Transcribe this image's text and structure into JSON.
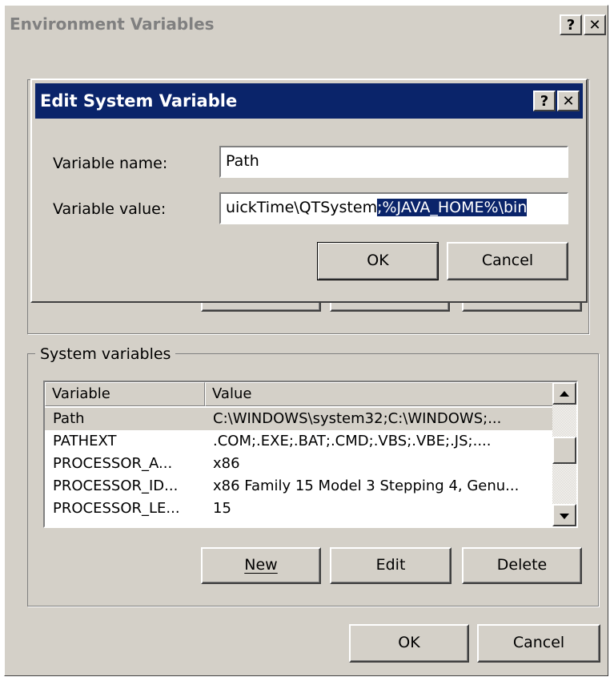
{
  "env_window": {
    "title": "Environment Variables",
    "help_glyph": "?",
    "close_glyph": "✕",
    "system_group": {
      "label": "System variables",
      "columns": [
        "Variable",
        "Value"
      ],
      "rows": [
        {
          "variable": "Path",
          "value": "C:\\WINDOWS\\system32;C:\\WINDOWS;..."
        },
        {
          "variable": "PATHEXT",
          "value": ".COM;.EXE;.BAT;.CMD;.VBS;.VBE;.JS;...."
        },
        {
          "variable": "PROCESSOR_A...",
          "value": "x86"
        },
        {
          "variable": "PROCESSOR_ID...",
          "value": "x86 Family 15 Model 3 Stepping 4, Genu..."
        },
        {
          "variable": "PROCESSOR_LE...",
          "value": "15"
        }
      ],
      "new_label": "New",
      "edit_label": "Edit",
      "delete_label": "Delete"
    },
    "ok_label": "OK",
    "cancel_label": "Cancel"
  },
  "edit_dialog": {
    "title": "Edit System Variable",
    "help_glyph": "?",
    "close_glyph": "✕",
    "name_label": "Variable name:",
    "name_value": "Path",
    "value_label": "Variable value:",
    "value_unselected": "uickTime\\QTSystem",
    "value_selected": ";%JAVA_HOME%\\bin",
    "ok_label": "OK",
    "cancel_label": "Cancel"
  },
  "icons": {
    "scroll_up": "up-arrow",
    "scroll_down": "down-arrow"
  }
}
